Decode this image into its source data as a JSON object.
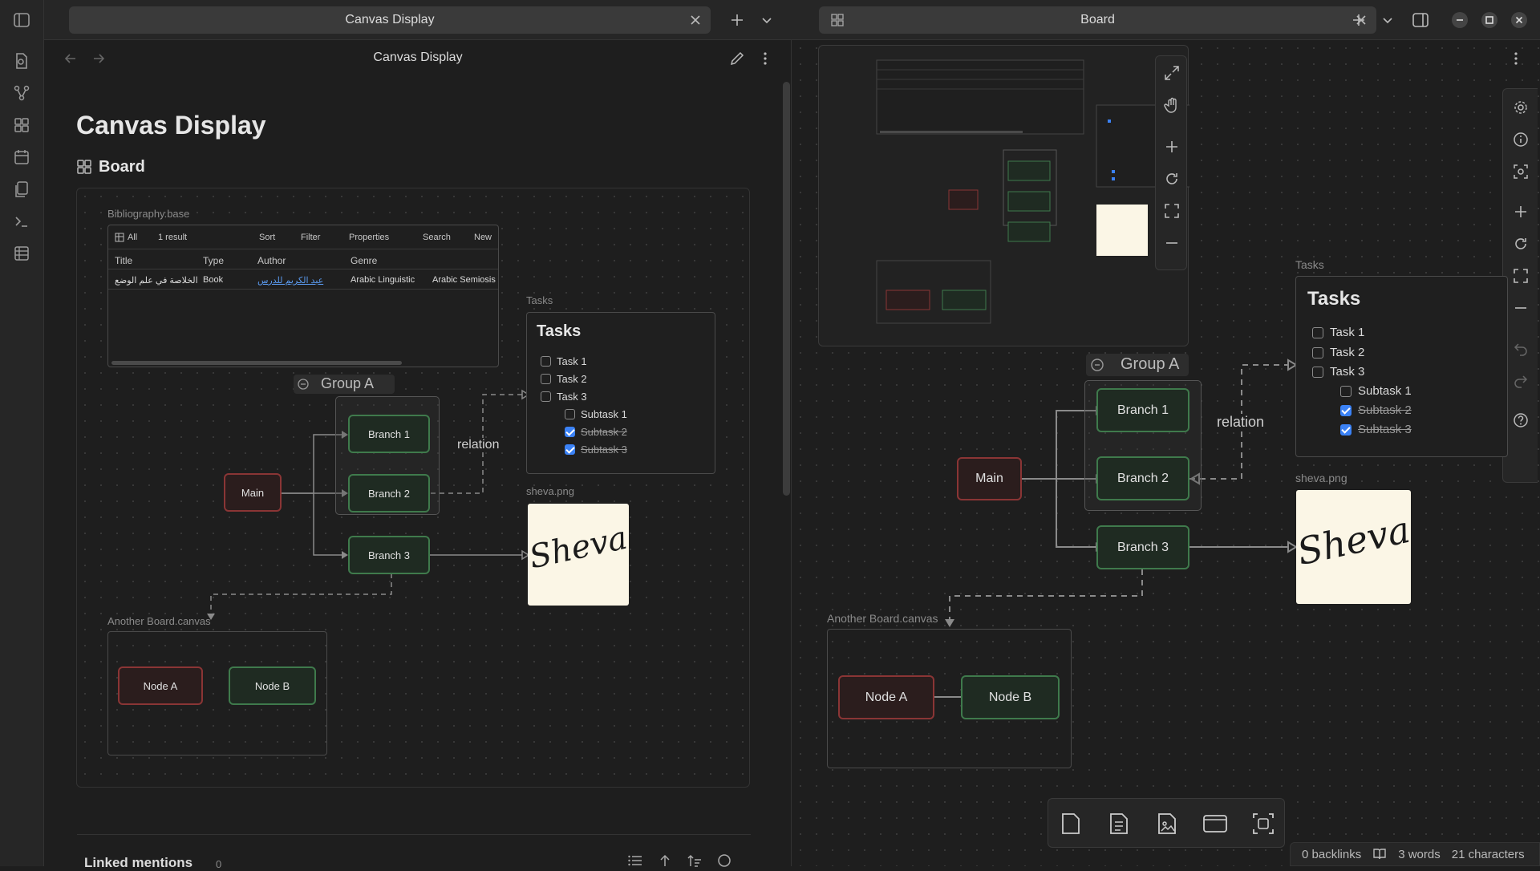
{
  "tabs": {
    "left_title": "Canvas Display",
    "right_title": "Board"
  },
  "left": {
    "header_title": "Canvas Display",
    "page_title": "Canvas Display",
    "section_title": "Board",
    "linked_mentions_label": "Linked mentions",
    "linked_mentions_count": "0"
  },
  "canvas": {
    "base_label": "Bibliography.base",
    "base_view": "All",
    "base_result_count": "1 result",
    "base_toolbar": [
      "Sort",
      "Filter",
      "Properties",
      "Search",
      "New"
    ],
    "base_columns": [
      "Title",
      "Type",
      "Author",
      "Genre"
    ],
    "base_row": {
      "title": "الخلاصة في علم الوضع",
      "type": "Book",
      "author": "عبد الكريم للدرس",
      "genre_1": "Arabic Linguistic",
      "genre_2": "Arabic Semiosis"
    },
    "tasks_label": "Tasks",
    "tasks_title": "Tasks",
    "tasks": [
      {
        "label": "Task 1",
        "done": false
      },
      {
        "label": "Task 2",
        "done": false
      },
      {
        "label": "Task 3",
        "done": false
      }
    ],
    "subtasks": [
      {
        "label": "Subtask 1",
        "done": false
      },
      {
        "label": "Subtask 2",
        "done": true
      },
      {
        "label": "Subtask 3",
        "done": true
      }
    ],
    "group_label": "Group A",
    "nodes": {
      "main": "Main",
      "branch1": "Branch 1",
      "branch2": "Branch 2",
      "branch3": "Branch 3",
      "node_a": "Node A",
      "node_b": "Node B"
    },
    "edge_label": "relation",
    "image_label": "sheva.png",
    "image_text": "Sheva",
    "embed_label": "Another Board.canvas"
  },
  "status": {
    "backlinks": "0 backlinks",
    "words": "3 words",
    "chars": "21 characters"
  },
  "colors": {
    "green_border": "#3f7a4c",
    "red_border": "#8a3535",
    "accent": "#3b82f6",
    "image_bg": "#fbf6e6"
  }
}
